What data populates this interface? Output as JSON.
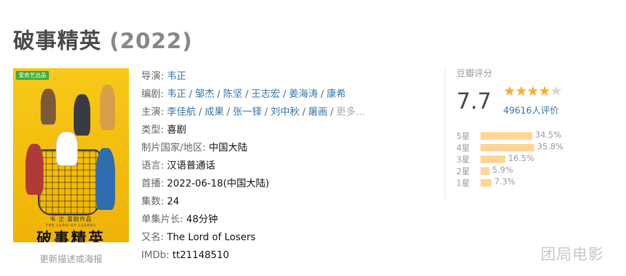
{
  "title": {
    "name": "破事精英",
    "year": "(2022)"
  },
  "poster": {
    "badge": "爱奇艺出品",
    "credit": "韦 正  喜剧作品",
    "subtitle_en": "THE LORD OF LOSERS",
    "logo_text": "破事精英",
    "update_link": "更新描述或海报"
  },
  "info": {
    "director": {
      "label": "导演",
      "names": [
        "韦正"
      ]
    },
    "writers": {
      "label": "编剧",
      "names": [
        "韦正",
        "邹杰",
        "陈坚",
        "王志宏",
        "姜海涛",
        "康希"
      ]
    },
    "cast": {
      "label": "主演",
      "names": [
        "李佳航",
        "成果",
        "张一铎",
        "刘中秋",
        "屠画"
      ],
      "more": "更多..."
    },
    "genre": {
      "label": "类型",
      "value": "喜剧"
    },
    "region": {
      "label": "制片国家/地区",
      "value": "中国大陆"
    },
    "language": {
      "label": "语言",
      "value": "汉语普通话"
    },
    "release": {
      "label": "首播",
      "value": "2022-06-18(中国大陆)"
    },
    "episodes": {
      "label": "集数",
      "value": "24"
    },
    "runtime": {
      "label": "单集片长",
      "value": "48分钟"
    },
    "aka": {
      "label": "又名",
      "value": "The Lord of Losers"
    },
    "imdb": {
      "label": "IMDb",
      "value": "tt21148510"
    }
  },
  "rating": {
    "label": "豆瓣评分",
    "score": "7.7",
    "stars_filled": 4,
    "stars_total": 5,
    "votes": "49616人评价",
    "distribution": [
      {
        "label": "5星",
        "percent": 34.5,
        "text": "34.5%"
      },
      {
        "label": "4星",
        "percent": 35.8,
        "text": "35.8%"
      },
      {
        "label": "3星",
        "percent": 16.5,
        "text": "16.5%"
      },
      {
        "label": "2星",
        "percent": 5.9,
        "text": "5.9%"
      },
      {
        "label": "1星",
        "percent": 7.3,
        "text": "7.3%"
      }
    ]
  },
  "colors": {
    "link": "#3377aa",
    "star": "#ffac2d",
    "bar": "#ffd596",
    "poster_bg": "#f3bd0c"
  },
  "watermark": "团局电影"
}
